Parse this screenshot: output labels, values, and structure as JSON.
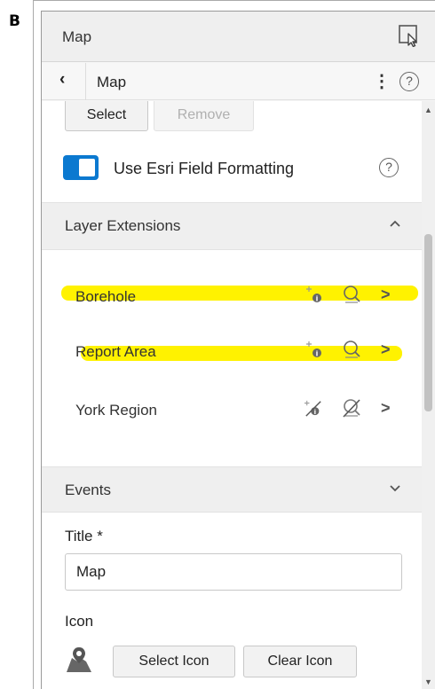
{
  "figure_label": "B",
  "panel": {
    "title": "Map",
    "select_tool_icon": "select-pointer-icon"
  },
  "nav": {
    "back_glyph": "‹",
    "title": "Map",
    "more_glyph": "⋮",
    "help_glyph": "?"
  },
  "buttons": {
    "select": "Select",
    "remove": "Remove"
  },
  "field_formatting": {
    "label": "Use Esri Field Formatting",
    "enabled": true,
    "help_glyph": "?"
  },
  "layer_extensions": {
    "title": "Layer Extensions",
    "expanded": true,
    "items": [
      {
        "label": "Borehole",
        "highlighted": true,
        "info_icon": "feature-info-icon",
        "zoom_icon": "zoom-to-icon",
        "disabled": false
      },
      {
        "label": "Report Area",
        "highlighted": true,
        "info_icon": "feature-info-icon",
        "zoom_icon": "zoom-to-icon",
        "disabled": false
      },
      {
        "label": "York Region",
        "highlighted": false,
        "info_icon": "feature-info-disabled-icon",
        "zoom_icon": "zoom-to-disabled-icon",
        "disabled": true
      }
    ]
  },
  "events": {
    "title": "Events",
    "expanded": false
  },
  "title_field": {
    "label": "Title *",
    "value": "Map"
  },
  "icon_field": {
    "label": "Icon",
    "icon": "map-pin-icon",
    "select_label": "Select Icon",
    "clear_label": "Clear Icon"
  },
  "colors": {
    "accent": "#0b79d0",
    "highlight": "#fff200"
  }
}
